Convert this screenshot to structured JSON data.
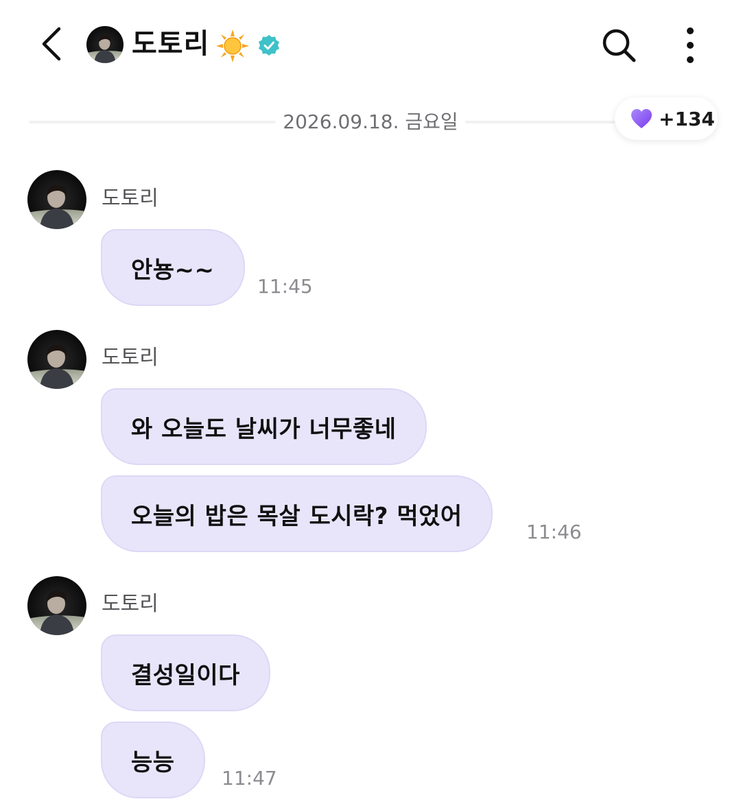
{
  "header": {
    "back_icon": "chevron-left-icon",
    "title": "도토리",
    "sun_emoji": "☀",
    "verified_icon": "verified-badge-icon",
    "search_icon": "search-icon",
    "more_icon": "more-vertical-icon"
  },
  "date_divider": {
    "date": "2026.09.18. 금요일"
  },
  "likes": {
    "count": "+134",
    "icon": "heart-icon",
    "color": "#8b5cf6"
  },
  "colors": {
    "bubble": "#e8e5fb",
    "bubble_border": "#dcd8f5",
    "time": "#8b8b90"
  },
  "messages": [
    {
      "sender": "도토리",
      "bubbles": [
        "안뇽~~"
      ],
      "time": "11:45"
    },
    {
      "sender": "도토리",
      "bubbles": [
        "와 오늘도 날씨가 너무좋네",
        "오늘의 밥은 목살 도시락? 먹었어"
      ],
      "time": "11:46"
    },
    {
      "sender": "도토리",
      "bubbles": [
        "결성일이다",
        "능능"
      ],
      "time": "11:47"
    }
  ]
}
